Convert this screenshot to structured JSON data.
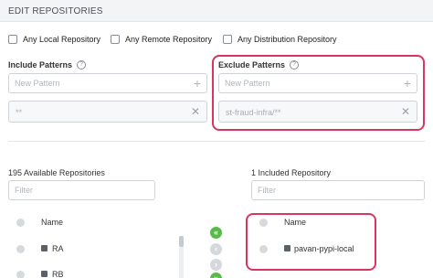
{
  "header": {
    "title": "EDIT REPOSITORIES"
  },
  "checkboxes": [
    {
      "label": "Any Local Repository",
      "checked": false
    },
    {
      "label": "Any Remote Repository",
      "checked": false
    },
    {
      "label": "Any Distribution Repository",
      "checked": false
    }
  ],
  "include": {
    "label": "Include Patterns",
    "help_icon": "?",
    "placeholder": "New Pattern",
    "patterns": [
      "**"
    ]
  },
  "exclude": {
    "label": "Exclude Patterns",
    "help_icon": "?",
    "placeholder": "New Pattern",
    "patterns": [
      "st-fraud-infra/**"
    ]
  },
  "available": {
    "title": "195 Available Repositories",
    "filter_placeholder": "Filter",
    "column_name": "Name",
    "items": [
      "RA",
      "RB"
    ]
  },
  "included": {
    "title": "1 Included Repository",
    "filter_placeholder": "Filter",
    "column_name": "Name",
    "items": [
      "pavan-pypi-local"
    ]
  },
  "move_buttons": {
    "include_all": "«",
    "include_one": "‹",
    "exclude_one": "›",
    "exclude_all": "»"
  },
  "colors": {
    "highlight": "#d8365e",
    "move_active": "#59b94a",
    "move_inactive": "#d6d9dc"
  }
}
